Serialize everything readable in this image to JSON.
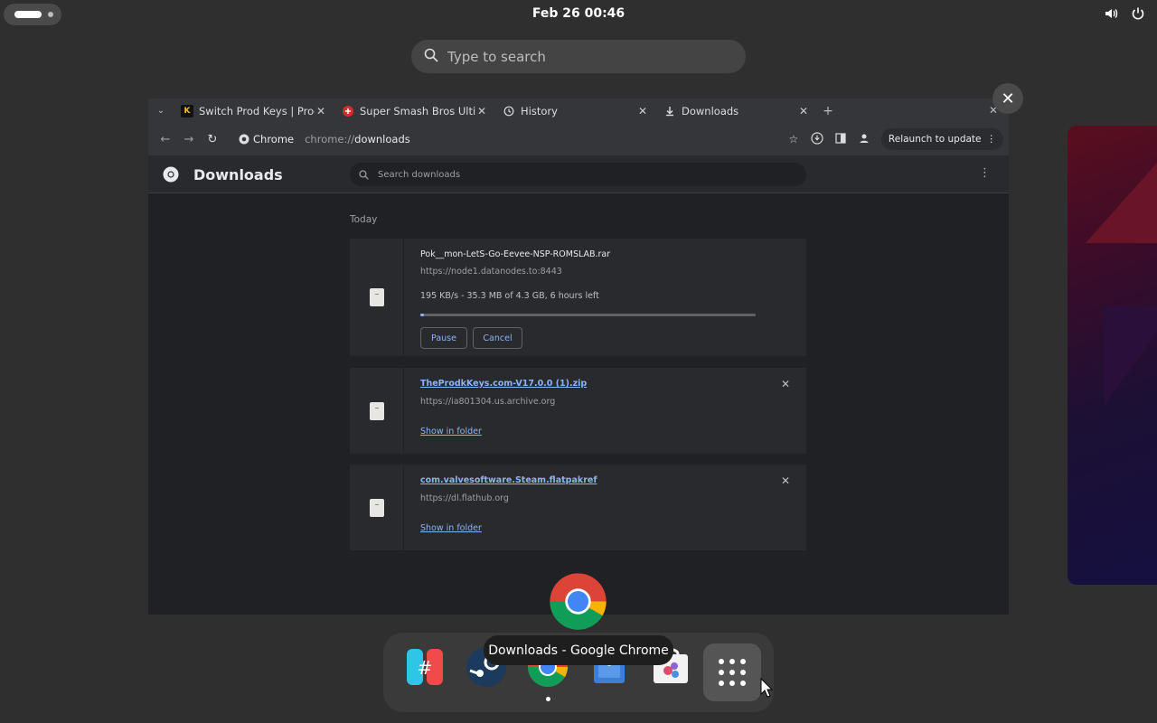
{
  "topbar": {
    "clock": "Feb 26  00:46"
  },
  "overview": {
    "search_placeholder": "Type to search",
    "tooltip": "Downloads - Google Chrome"
  },
  "browser": {
    "tabs": [
      {
        "title": "Switch Prod Keys | Prod…",
        "favicon": "K"
      },
      {
        "title": "Super Smash Bros Ultima…",
        "favicon": "flag"
      },
      {
        "title": "History",
        "favicon": "history-icon"
      },
      {
        "title": "Downloads",
        "favicon": "download-icon"
      }
    ],
    "omnibox": {
      "chip": "Chrome",
      "url_prefix": "chrome://",
      "url_path": "downloads"
    },
    "relaunch_label": "Relaunch to update"
  },
  "downloads_page": {
    "title": "Downloads",
    "search_placeholder": "Search downloads",
    "section_today": "Today",
    "items": [
      {
        "name": "Pok__mon-LetS-Go-Eevee-NSP-ROMSLAB.rar",
        "source": "https://node1.datanodes.to:8443",
        "status": "195 KB/s - 35.3 MB of 4.3 GB, 6 hours left",
        "progress": 0.008,
        "pause_label": "Pause",
        "cancel_label": "Cancel"
      },
      {
        "name": "TheProdkKeys.com-V17.0.0 (1).zip",
        "source": "https://ia801304.us.archive.org",
        "action": "Show in folder"
      },
      {
        "name": "com.valvesoftware.Steam.flatpakref",
        "source": "https://dl.flathub.org",
        "action": "Show in folder"
      }
    ]
  },
  "dock": {
    "apps": [
      "hashtag-app-icon",
      "steam-icon",
      "chrome-icon",
      "file-icon",
      "software-store-icon",
      "app-grid-icon"
    ]
  }
}
